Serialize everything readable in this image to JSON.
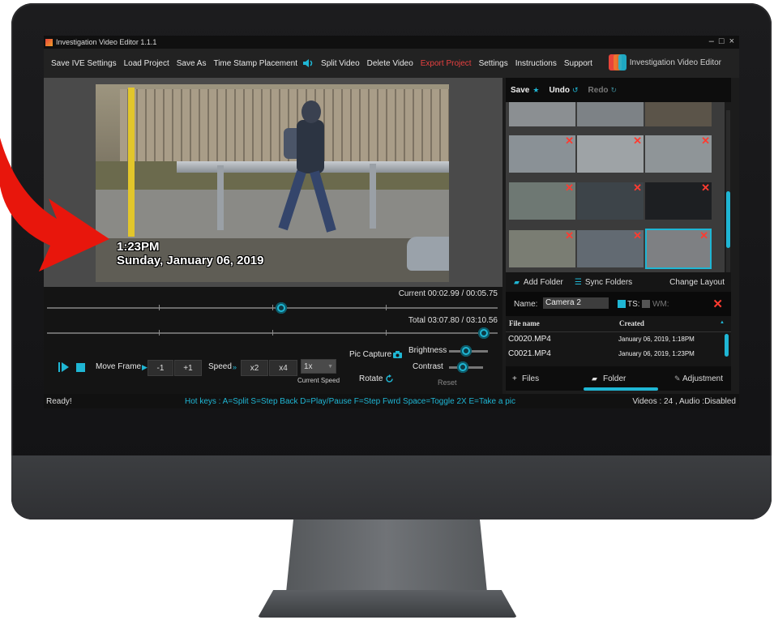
{
  "app": {
    "title": "Investigation Video Editor 1.1.1",
    "window_controls": [
      "–",
      "□",
      "×"
    ]
  },
  "menu": [
    "Save IVE Settings",
    "Load Project",
    "Save As",
    "Time Stamp Placement",
    "Split Video",
    "Delete Video",
    "Export Project",
    "Settings",
    "Instructions",
    "Support"
  ],
  "brand": {
    "name": "Investigation Video Editor"
  },
  "video": {
    "osd_time": "1:23PM",
    "osd_date": "Sunday, January 06, 2019"
  },
  "timeline": {
    "current": "Current 00:02.99 / 00:05.75",
    "total": "Total 03:07.80 / 03:10.56",
    "current_fraction": 0.52,
    "total_fraction": 0.97
  },
  "controls": {
    "move_frame": "Move Frame",
    "minus_one": "-1",
    "plus_one": "+1",
    "speed": "Speed",
    "x2": "x2",
    "x4": "x4",
    "speed_value": "1x",
    "current_speed": "Current Speed",
    "pic_capture": "Pic Capture",
    "rotate": "Rotate",
    "brightness": "Brightness",
    "contrast": "Contrast",
    "reset": "Reset"
  },
  "status": {
    "ready": "Ready!",
    "hotkeys": "Hot keys : A=Split   S=Step Back   D=Play/Pause   F=Step Fwrd   Space=Toggle 2X   E=Take a pic",
    "videos": "Videos : 24 , Audio :Disabled"
  },
  "right_panel": {
    "save": "Save",
    "undo": "Undo",
    "redo": "Redo",
    "add_folder": "Add Folder",
    "sync_folders": "Sync Folders",
    "change_layout": "Change Layout",
    "name_label": "Name:",
    "name_value": "Camera 2",
    "ts_label": "TS:",
    "wm_label": "WM:",
    "col_file": "File name",
    "col_created": "Created",
    "files": [
      {
        "name": "C0020.MP4",
        "created": "January 06, 2019, 1:18PM"
      },
      {
        "name": "C0021.MP4",
        "created": "January 06, 2019, 1:23PM"
      }
    ],
    "tab_files": "Files",
    "tab_folder": "Folder",
    "tab_adjustment": "Adjustment"
  },
  "colors": {
    "accent": "#1fb6d4",
    "export": "#e84040",
    "delete_x": "#ff3b30",
    "arrow": "#e8160c"
  }
}
